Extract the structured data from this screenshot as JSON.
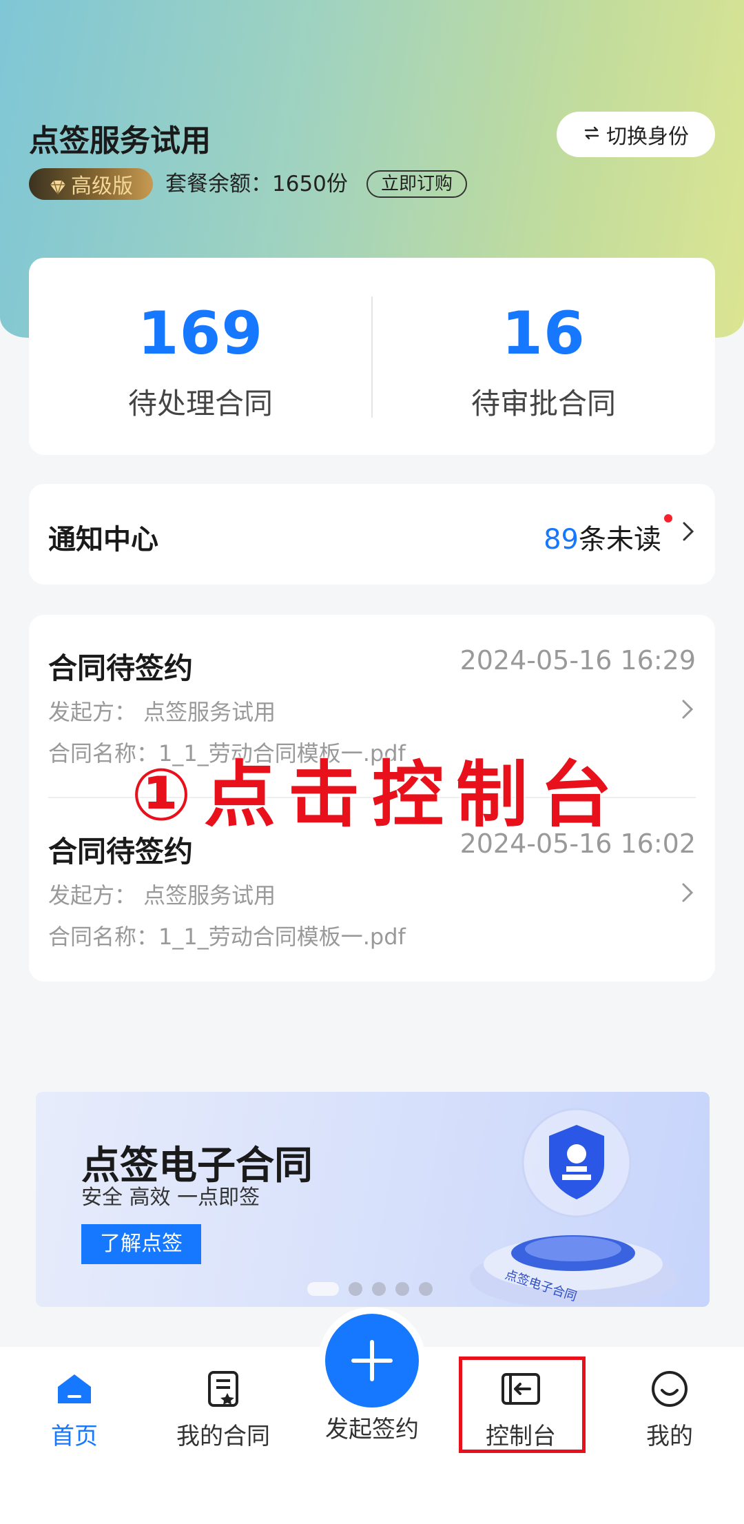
{
  "header": {
    "org_name": "点签服务试用",
    "switch_label": "切换身份",
    "vip_label": "高级版",
    "quota_text": "套餐余额：1650份",
    "buy_label": "立即订购"
  },
  "stats": [
    {
      "value": "169",
      "label": "待处理合同"
    },
    {
      "value": "16",
      "label": "待审批合同"
    }
  ],
  "notice": {
    "title": "通知中心",
    "count": "89",
    "count_suffix": "条未读"
  },
  "tasks": [
    {
      "title": "合同待签约",
      "time": "2024-05-16 16:29",
      "initiator": "发起方：  点签服务试用",
      "contract": "合同名称：1_1_劳动合同模板一.pdf"
    },
    {
      "title": "合同待签约",
      "time": "2024-05-16 16:02",
      "initiator": "发起方：  点签服务试用",
      "contract": "合同名称：1_1_劳动合同模板一.pdf"
    }
  ],
  "overlay_instruction": "①点击控制台",
  "banner": {
    "title": "点签电子合同",
    "subtitle": "安全 高效 一点即签",
    "button": "了解点签",
    "pedestal_text": "点签电子合同",
    "slide_index": 1,
    "slide_count": 5
  },
  "tabbar": {
    "home": "首页",
    "my_contracts": "我的合同",
    "initiate": "发起签约",
    "console": "控制台",
    "mine": "我的"
  },
  "colors": {
    "accent": "#1677ff",
    "highlight": "#e8101a"
  }
}
